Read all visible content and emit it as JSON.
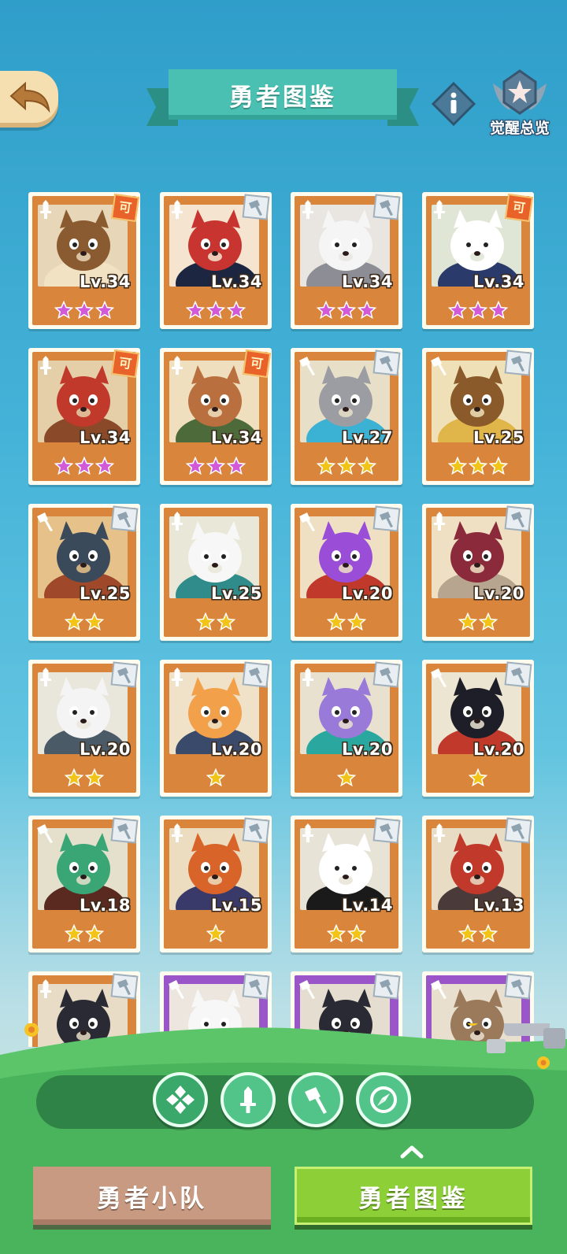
{
  "header": {
    "title": "勇者图鉴",
    "awaken_label": "觉醒总览"
  },
  "tabs": {
    "squad": "勇者小队",
    "codex": "勇者图鉴"
  },
  "filters": [
    "all-icon",
    "sword-icon",
    "hammer-icon",
    "compass-icon"
  ],
  "heroes": [
    {
      "level": "Lv.34",
      "stars": 3,
      "star_color": "#d25ad8",
      "role": "sword",
      "tag": "awaken",
      "palette": [
        "#e7d6b7",
        "#8a5a30",
        "#f1e2c4"
      ],
      "frame": "orange"
    },
    {
      "level": "Lv.34",
      "stars": 3,
      "star_color": "#d25ad8",
      "role": "sword",
      "tag": "weapon",
      "palette": [
        "#f4e4d0",
        "#c8342f",
        "#1d2640"
      ],
      "frame": "orange"
    },
    {
      "level": "Lv.34",
      "stars": 3,
      "star_color": "#d25ad8",
      "role": "sword",
      "tag": "weapon",
      "palette": [
        "#e9e6e2",
        "#f5f5f5",
        "#8d8d95"
      ],
      "frame": "orange"
    },
    {
      "level": "Lv.34",
      "stars": 3,
      "star_color": "#d25ad8",
      "role": "sword",
      "tag": "awaken",
      "palette": [
        "#dfe6d5",
        "#ffffff",
        "#2a3a6a"
      ],
      "frame": "orange"
    },
    {
      "level": "Lv.34",
      "stars": 3,
      "star_color": "#d25ad8",
      "role": "sword",
      "tag": "awaken",
      "palette": [
        "#e5cfa8",
        "#c0392b",
        "#8a4a2a"
      ],
      "frame": "orange"
    },
    {
      "level": "Lv.34",
      "stars": 3,
      "star_color": "#d25ad8",
      "role": "sword",
      "tag": "awaken",
      "palette": [
        "#f0dfbf",
        "#b9703e",
        "#4d6a3a"
      ],
      "frame": "orange"
    },
    {
      "level": "Lv.27",
      "stars": 3,
      "star_color": "#f2c418",
      "role": "hammer",
      "tag": "weapon",
      "palette": [
        "#e8dfc8",
        "#9c9ca3",
        "#3bb2d4"
      ],
      "frame": "orange"
    },
    {
      "level": "Lv.25",
      "stars": 3,
      "star_color": "#f2c418",
      "role": "hammer",
      "tag": "weapon",
      "palette": [
        "#efe0b8",
        "#8a5a2a",
        "#e0b64a"
      ],
      "frame": "orange"
    },
    {
      "level": "Lv.25",
      "stars": 2,
      "star_color": "#f2c418",
      "role": "hammer",
      "tag": "weapon",
      "palette": [
        "#e7c18a",
        "#3a4a5a",
        "#a0482a"
      ],
      "frame": "orange"
    },
    {
      "level": "Lv.25",
      "stars": 2,
      "star_color": "#f2c418",
      "role": "sword",
      "tag": "none",
      "palette": [
        "#e9e8d8",
        "#f7f7f7",
        "#2f8c8a"
      ],
      "frame": "orange"
    },
    {
      "level": "Lv.20",
      "stars": 2,
      "star_color": "#f2c418",
      "role": "hammer",
      "tag": "weapon",
      "palette": [
        "#efe0c4",
        "#9a4ed8",
        "#c0392b"
      ],
      "frame": "orange"
    },
    {
      "level": "Lv.20",
      "stars": 2,
      "star_color": "#f2c418",
      "role": "sword",
      "tag": "weapon",
      "palette": [
        "#efe0c4",
        "#8a2a3a",
        "#b7a58f"
      ],
      "frame": "orange"
    },
    {
      "level": "Lv.20",
      "stars": 2,
      "star_color": "#f2c418",
      "role": "sword",
      "tag": "weapon",
      "palette": [
        "#e9e6dc",
        "#f4f4f4",
        "#4a5a66"
      ],
      "frame": "orange"
    },
    {
      "level": "Lv.20",
      "stars": 1,
      "star_color": "#f2c418",
      "role": "sword",
      "tag": "weapon",
      "palette": [
        "#f0e2c8",
        "#f2a04a",
        "#3a4a6a"
      ],
      "frame": "orange"
    },
    {
      "level": "Lv.20",
      "stars": 1,
      "star_color": "#f2c418",
      "role": "sword",
      "tag": "weapon",
      "palette": [
        "#e9e1d0",
        "#9a7ad8",
        "#2aa8a0"
      ],
      "frame": "orange"
    },
    {
      "level": "Lv.20",
      "stars": 1,
      "star_color": "#f2c418",
      "role": "hammer",
      "tag": "weapon",
      "palette": [
        "#ece5d2",
        "#1e1e28",
        "#c0392b"
      ],
      "frame": "orange"
    },
    {
      "level": "Lv.18",
      "stars": 2,
      "star_color": "#f2c418",
      "role": "hammer",
      "tag": "weapon",
      "palette": [
        "#e5e0cc",
        "#3aa676",
        "#5a2a20"
      ],
      "frame": "orange"
    },
    {
      "level": "Lv.15",
      "stars": 1,
      "star_color": "#f2c418",
      "role": "sword",
      "tag": "weapon",
      "palette": [
        "#ecdcc0",
        "#d8642a",
        "#3a3a6a"
      ],
      "frame": "orange"
    },
    {
      "level": "Lv.14",
      "stars": 2,
      "star_color": "#f2c418",
      "role": "sword",
      "tag": "weapon",
      "palette": [
        "#e7e3d6",
        "#ffffff",
        "#1a1a1a"
      ],
      "frame": "orange"
    },
    {
      "level": "Lv.13",
      "stars": 2,
      "star_color": "#f2c418",
      "role": "sword",
      "tag": "weapon",
      "palette": [
        "#e9dcc4",
        "#c0392b",
        "#4a3a3a"
      ],
      "frame": "orange"
    },
    {
      "level": "",
      "stars": 0,
      "star_color": "#f2c418",
      "role": "sword",
      "tag": "weapon",
      "palette": [
        "#e8dcc6",
        "#2a2a34",
        "#8a8a94"
      ],
      "frame": "orange"
    },
    {
      "level": "",
      "stars": 0,
      "star_color": "#f2c418",
      "role": "hammer",
      "tag": "weapon",
      "palette": [
        "#ece6de",
        "#f7f7f7",
        "#7abbe0"
      ],
      "frame": "purple"
    },
    {
      "level": "",
      "stars": 0,
      "star_color": "#f2c418",
      "role": "hammer",
      "tag": "weapon",
      "palette": [
        "#e5ddd0",
        "#2a2a34",
        "#d03a2a"
      ],
      "frame": "purple"
    },
    {
      "level": "",
      "stars": 0,
      "star_color": "#f2c418",
      "role": "hammer",
      "tag": "weapon",
      "palette": [
        "#e8dfcf",
        "#9a7a5a",
        "#7a8a9a"
      ],
      "frame": "purple"
    }
  ]
}
